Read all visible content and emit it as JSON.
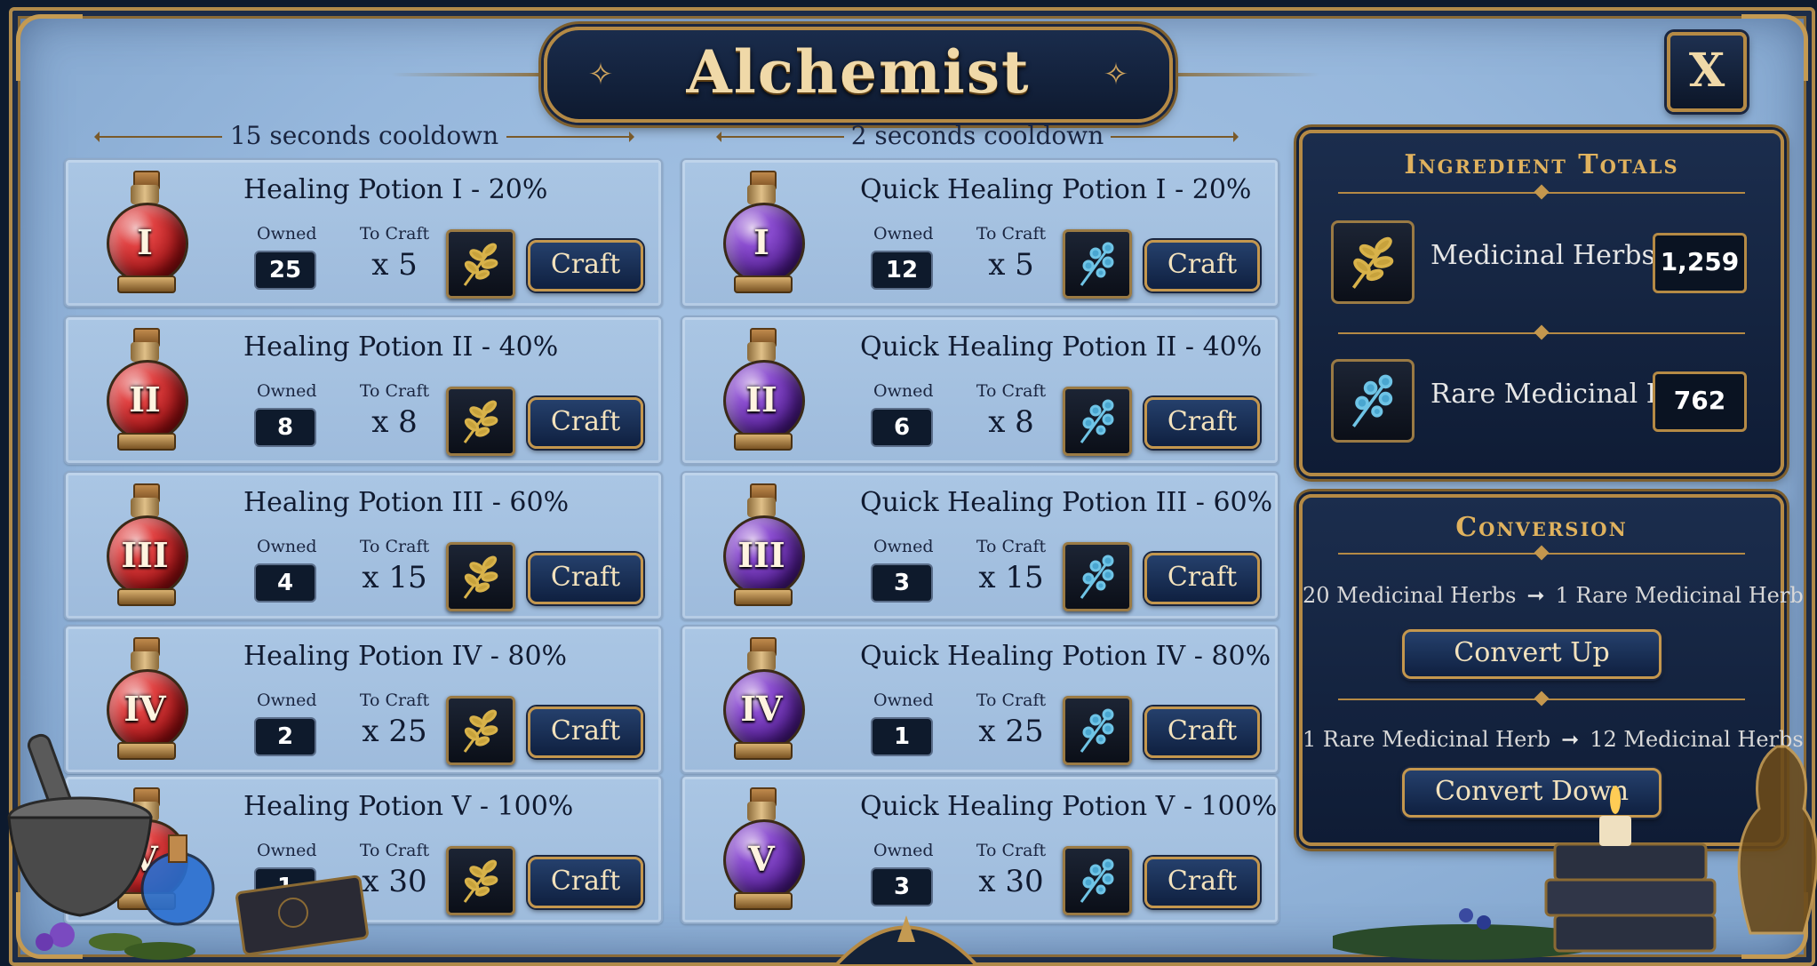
{
  "window": {
    "title": "Alchemist",
    "close_label": "X"
  },
  "sections": [
    {
      "cooldown": "15 seconds cooldown"
    },
    {
      "cooldown": "2 seconds cooldown"
    }
  ],
  "healing": [
    {
      "name": "Healing Potion I - 20%",
      "numeral": "I",
      "owned": "25",
      "to_craft": "x 5"
    },
    {
      "name": "Healing Potion II - 40%",
      "numeral": "II",
      "owned": "8",
      "to_craft": "x 8"
    },
    {
      "name": "Healing Potion III - 60%",
      "numeral": "III",
      "owned": "4",
      "to_craft": "x 15"
    },
    {
      "name": "Healing Potion IV - 80%",
      "numeral": "IV",
      "owned": "2",
      "to_craft": "x 25"
    },
    {
      "name": "Healing Potion V - 100%",
      "numeral": "V",
      "owned": "1",
      "to_craft": "x 30"
    }
  ],
  "quick": [
    {
      "name": "Quick Healing Potion I - 20%",
      "numeral": "I",
      "owned": "12",
      "to_craft": "x 5"
    },
    {
      "name": "Quick Healing Potion II - 40%",
      "numeral": "II",
      "owned": "6",
      "to_craft": "x 8"
    },
    {
      "name": "Quick Healing Potion III - 60%",
      "numeral": "III",
      "owned": "3",
      "to_craft": "x 15"
    },
    {
      "name": "Quick Healing Potion IV - 80%",
      "numeral": "IV",
      "owned": "1",
      "to_craft": "x 25"
    },
    {
      "name": "Quick Healing Potion V - 100%",
      "numeral": "V",
      "owned": "3",
      "to_craft": "x 30"
    }
  ],
  "labels": {
    "owned": "Owned",
    "to_craft": "To Craft",
    "craft": "Craft"
  },
  "ingredients": {
    "title": "Ingredient Totals",
    "items": [
      {
        "name": "Medicinal Herbs",
        "value": "1,259",
        "icon": "golden-herb-icon"
      },
      {
        "name": "Rare Medicinal Herbs",
        "value": "762",
        "icon": "blue-herb-icon"
      }
    ]
  },
  "conversion": {
    "title": "Conversion",
    "up": {
      "from": "20 Medicinal Herbs",
      "to": "1 Rare Medicinal Herb",
      "button": "Convert Up"
    },
    "down": {
      "from": "1 Rare Medicinal Herb",
      "to": "12 Medicinal Herbs",
      "button": "Convert Down"
    }
  },
  "colors": {
    "frame_gold": "#b58a45",
    "panel_navy": "#1b2d4d",
    "background_blue": "#96b7dc",
    "red_potion": "#9a0f12",
    "purple_potion": "#4c1a8a"
  }
}
